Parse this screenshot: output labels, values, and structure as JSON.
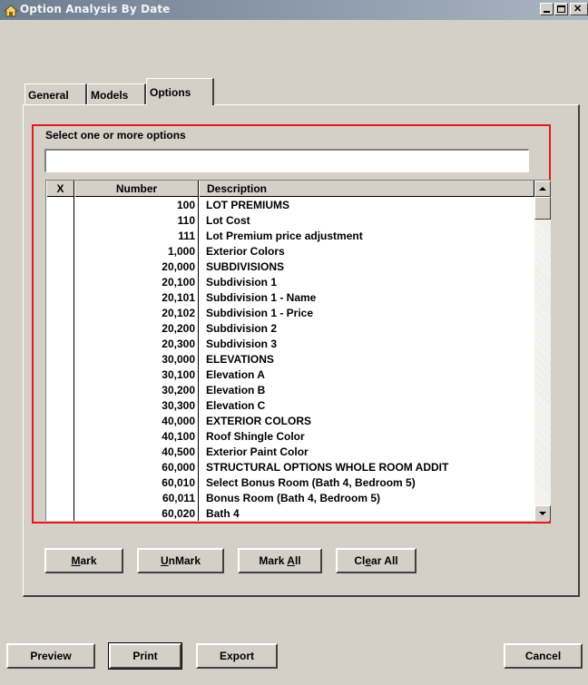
{
  "window": {
    "title": "Option Analysis By Date",
    "minimize_glyph": "_",
    "maximize_glyph": "□",
    "close_glyph": "✕"
  },
  "tabs": [
    {
      "label": "General"
    },
    {
      "label": "Models"
    },
    {
      "label": "Options",
      "active": true
    }
  ],
  "options_panel": {
    "select_label": "Select one or more options",
    "search_value": ""
  },
  "grid": {
    "columns": {
      "x": "X",
      "number": "Number",
      "description": "Description"
    },
    "rows": [
      {
        "number": "100",
        "description": "LOT PREMIUMS"
      },
      {
        "number": "110",
        "description": "Lot Cost"
      },
      {
        "number": "111",
        "description": "Lot Premium price adjustment"
      },
      {
        "number": "1,000",
        "description": "Exterior Colors"
      },
      {
        "number": "20,000",
        "description": "SUBDIVISIONS"
      },
      {
        "number": "20,100",
        "description": "Subdivision 1"
      },
      {
        "number": "20,101",
        "description": "Subdivision 1 - Name"
      },
      {
        "number": "20,102",
        "description": "Subdivision 1 - Price"
      },
      {
        "number": "20,200",
        "description": "Subdivision 2"
      },
      {
        "number": "20,300",
        "description": "Subdivision 3"
      },
      {
        "number": "30,000",
        "description": "ELEVATIONS"
      },
      {
        "number": "30,100",
        "description": "Elevation A"
      },
      {
        "number": "30,200",
        "description": "Elevation B"
      },
      {
        "number": "30,300",
        "description": "Elevation C"
      },
      {
        "number": "40,000",
        "description": "EXTERIOR COLORS"
      },
      {
        "number": "40,100",
        "description": "Roof Shingle Color"
      },
      {
        "number": "40,500",
        "description": "Exterior Paint Color"
      },
      {
        "number": "60,000",
        "description": "STRUCTURAL OPTIONS WHOLE ROOM ADDIT"
      },
      {
        "number": "60,010",
        "description": "Select Bonus Room (Bath 4, Bedroom 5)"
      },
      {
        "number": "60,011",
        "description": "Bonus Room (Bath 4, Bedroom 5)"
      },
      {
        "number": "60,020",
        "description": "Bath 4"
      }
    ]
  },
  "grid_buttons": {
    "mark": {
      "pre": "",
      "ul": "M",
      "post": "ark"
    },
    "unmark": {
      "pre": "",
      "ul": "U",
      "post": "nMark"
    },
    "mark_all": {
      "pre": "Mark ",
      "ul": "A",
      "post": "ll"
    },
    "clear_all": {
      "pre": "Cl",
      "ul": "e",
      "post": "ar All"
    }
  },
  "footer": {
    "preview": "Preview",
    "print": "Print",
    "export": "Export",
    "cancel": "Cancel"
  },
  "colors": {
    "titlebar": "#7b8a9c",
    "face": "#d4d0c8",
    "highlight_box": "#e21a1a"
  }
}
